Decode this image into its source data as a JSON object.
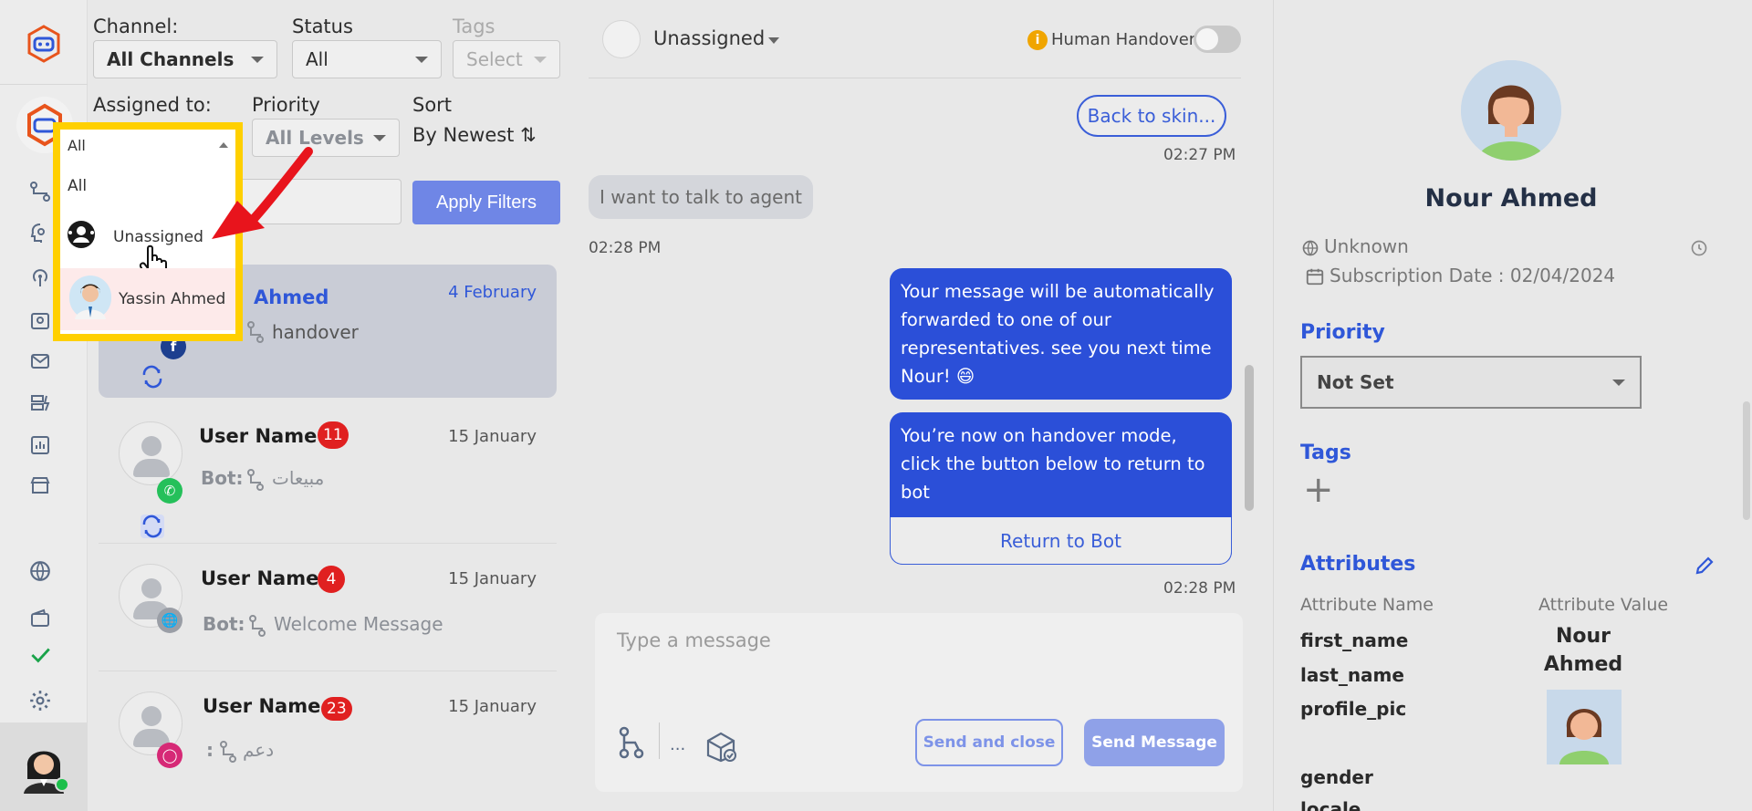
{
  "filters": {
    "channel_label": "Channel:",
    "channel_value": "All Channels",
    "status_label": "Status",
    "status_value": "All",
    "tags_label": "Tags",
    "tags_placeholder": "Select",
    "assigned_label": "Assigned to:",
    "priority_label": "Priority",
    "priority_value": "All Levels",
    "sort_label": "Sort",
    "sort_value": "By Newest ⇅",
    "apply_label": "Apply Filters"
  },
  "assigned_dropdown": {
    "selected": "All",
    "options": [
      "All",
      "Unassigned",
      "Yassin Ahmed"
    ]
  },
  "conversations": [
    {
      "name": "Ahmed",
      "date": "4 February",
      "preview": "handover",
      "channel": "facebook"
    },
    {
      "name": "User Name",
      "badge": "11",
      "date": "15 January",
      "prefix": "Bot:",
      "preview": "مبيعات",
      "channel": "whatsapp"
    },
    {
      "name": "User Name",
      "badge": "4",
      "date": "15 January",
      "prefix": "Bot:",
      "preview": "Welcome Message",
      "channel": "web"
    },
    {
      "name": "User Name",
      "badge": "23",
      "date": "15 January",
      "prefix": ":",
      "preview": "دعم",
      "channel": "instagram"
    }
  ],
  "chat": {
    "assignee": "Unassigned",
    "handover_label": "Human Handover",
    "back_button": "Back to skin...",
    "time1": "02:27 PM",
    "incoming_text": "I want to talk to agent",
    "time2": "02:28 PM",
    "bot_msg1": "Your message will be automatically forwarded to one of our representatives. see you next time Nour! 😄",
    "bot_msg2": "You’re now on handover mode, click the button below to return to bot",
    "return_button": "Return to Bot",
    "time3": "02:28 PM",
    "composer_placeholder": "Type a message",
    "more_dots": "...",
    "send_close": "Send and close",
    "send_message": "Send Message"
  },
  "profile": {
    "name": "Nour Ahmed",
    "location": "Unknown",
    "subscription": "Subscription Date : 02/04/2024",
    "priority_title": "Priority",
    "priority_value": "Not Set",
    "tags_title": "Tags",
    "tags_add": "+",
    "attributes_title": "Attributes",
    "attr_name_header": "Attribute Name",
    "attr_value_header": "Attribute Value",
    "attrs": [
      "first_name",
      "last_name",
      "profile_pic",
      "gender",
      "locale"
    ],
    "first_name_value": "Nour Ahmed"
  },
  "colors": {
    "accent": "#2b4fd8",
    "highlight_frame": "#ffd000",
    "annotation_arrow": "#e8141c",
    "badge": "#e02020"
  }
}
